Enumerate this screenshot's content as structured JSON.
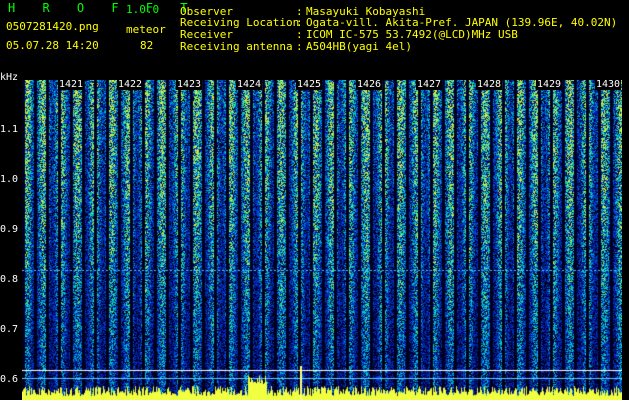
{
  "app": {
    "title": "H R O F F T",
    "version": "1.0.0"
  },
  "file": {
    "name": "0507281420.png",
    "datetime": "05.07.28 14:20"
  },
  "detection": {
    "mode": "meteor",
    "count": "82"
  },
  "info": [
    {
      "key": "Observer",
      "value": "Masayuki Kobayashi"
    },
    {
      "key": "Receiving Location",
      "value": "Ogata-vill. Akita-Pref. JAPAN (139.96E, 40.02N)"
    },
    {
      "key": "Receiver",
      "value": "ICOM IC-575 53.7492(@LCD)MHz USB"
    },
    {
      "key": "Receiving antenna",
      "value": "A504HB(yagi 4el)"
    }
  ],
  "separator": ":",
  "y_axis": {
    "unit": "kHz",
    "ticks": [
      "1.1",
      "1.0",
      "0.9",
      "0.8",
      "0.7",
      "0.6"
    ]
  },
  "time_ticks": [
    "1421",
    "1422",
    "1423",
    "1424",
    "1425",
    "1426",
    "1427",
    "1428",
    "1429",
    "1430"
  ],
  "colors": {
    "header_text": "#ffff00",
    "title": "#00ff00",
    "axis_text": "#ffffff",
    "background": "#000000"
  }
}
